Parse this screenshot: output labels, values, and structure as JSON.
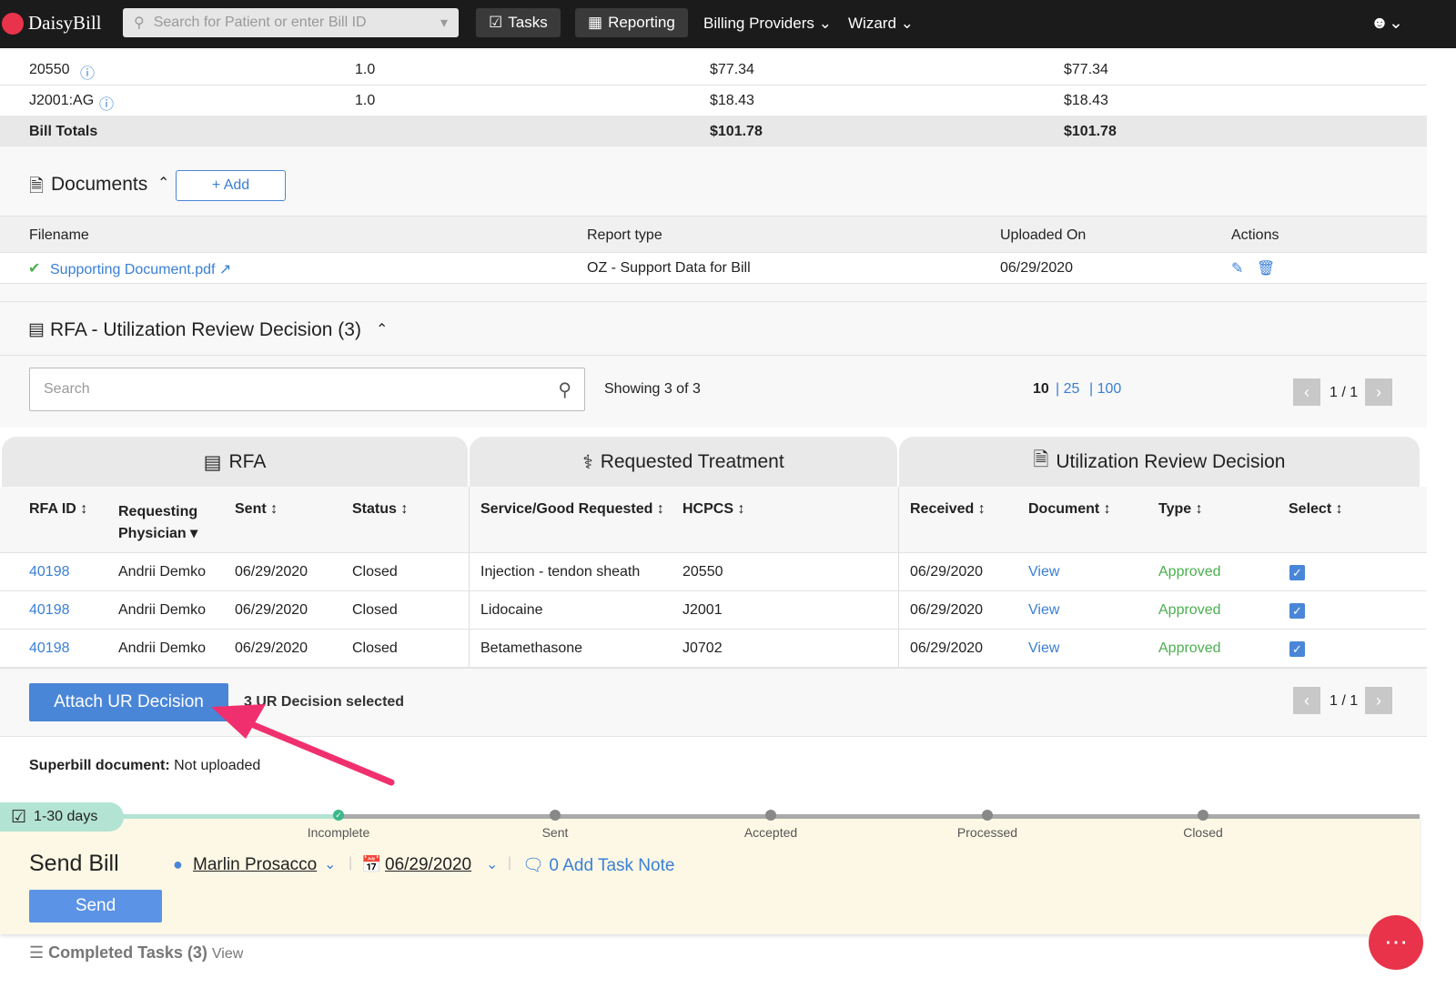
{
  "nav": {
    "brand": "DaisyBill",
    "search_placeholder": "Search for Patient or enter Bill ID",
    "tasks": "Tasks",
    "reporting": "Reporting",
    "billing_providers": "Billing Providers",
    "wizard": "Wizard"
  },
  "bill_lines": [
    {
      "code": "20550",
      "units": "1.0",
      "charge": "$77.34",
      "allowed": "$77.34"
    },
    {
      "code": "J2001:AG",
      "units": "1.0",
      "charge": "$18.43",
      "allowed": "$18.43"
    }
  ],
  "bill_totals": {
    "label": "Bill Totals",
    "charge": "$101.78",
    "allowed": "$101.78"
  },
  "documents": {
    "title": "Documents",
    "add": "Add",
    "headers": [
      "Filename",
      "Report type",
      "Uploaded On",
      "Actions"
    ],
    "rows": [
      {
        "filename": "Supporting Document.pdf",
        "report_type": "OZ - Support Data for Bill",
        "uploaded": "06/29/2020"
      }
    ]
  },
  "rfa": {
    "title": "RFA - Utilization Review Decision (3)",
    "search_placeholder": "Search",
    "showing": "Showing 3 of 3",
    "page_sizes": [
      "10",
      "25",
      "100"
    ],
    "page": "1 / 1",
    "groups": [
      "RFA",
      "Requested Treatment",
      "Utilization Review Decision"
    ],
    "headers": [
      "RFA ID",
      "Requesting Physician",
      "Sent",
      "Status",
      "Service/Good Requested",
      "HCPCS",
      "Received",
      "Document",
      "Type",
      "Select"
    ],
    "rows": [
      {
        "id": "40198",
        "physician": "Andrii Demko",
        "sent": "06/29/2020",
        "status": "Closed",
        "service": "Injection - tendon sheath",
        "hcpcs": "20550",
        "received": "06/29/2020",
        "document": "View",
        "type": "Approved"
      },
      {
        "id": "40198",
        "physician": "Andrii Demko",
        "sent": "06/29/2020",
        "status": "Closed",
        "service": "Lidocaine",
        "hcpcs": "J2001",
        "received": "06/29/2020",
        "document": "View",
        "type": "Approved"
      },
      {
        "id": "40198",
        "physician": "Andrii Demko",
        "sent": "06/29/2020",
        "status": "Closed",
        "service": "Betamethasone",
        "hcpcs": "J0702",
        "received": "06/29/2020",
        "document": "View",
        "type": "Approved"
      }
    ],
    "attach": "Attach UR Decision",
    "selected": "3 UR Decision selected"
  },
  "superbill": {
    "label": "Superbill document:",
    "value": "Not uploaded"
  },
  "task": {
    "badge": "1-30 days",
    "steps": [
      "Incomplete",
      "Sent",
      "Accepted",
      "Processed",
      "Closed"
    ],
    "title": "Send Bill",
    "assignee": "Marlin Prosacco",
    "date": "06/29/2020",
    "note": "0 Add Task Note",
    "send": "Send"
  },
  "completed": {
    "label": "Completed Tasks (3)",
    "view": "View"
  },
  "colors": {
    "accent": "#4a86d8",
    "annotation_arrow": "#f0306e",
    "task_bg": "#fdf8e5"
  }
}
